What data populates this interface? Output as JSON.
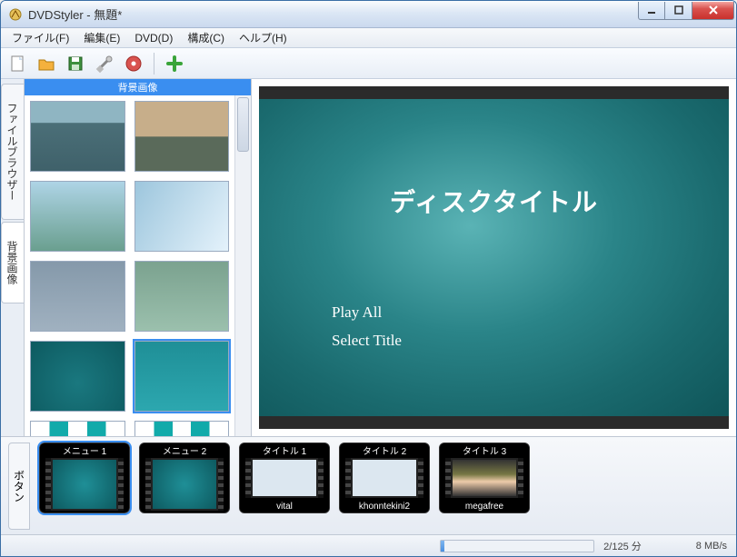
{
  "window": {
    "title": "DVDStyler - 無題*"
  },
  "menu": {
    "file": "ファイル(F)",
    "edit": "編集(E)",
    "dvd": "DVD(D)",
    "config": "構成(C)",
    "help": "ヘルプ(H)"
  },
  "tabs": {
    "file_browser": "ファイルブラウザー",
    "bg_images": "背景画像",
    "button": "ボタン"
  },
  "side_header": "背景画像",
  "preview": {
    "disc_title": "ディスクタイトル",
    "play_all": "Play All",
    "select_title": "Select Title"
  },
  "timeline": {
    "items": [
      {
        "cap": "メニュー 1",
        "sub": ""
      },
      {
        "cap": "メニュー 2",
        "sub": ""
      },
      {
        "cap": "タイトル 1",
        "sub": "vital"
      },
      {
        "cap": "タイトル 2",
        "sub": "khonntekini2"
      },
      {
        "cap": "タイトル 3",
        "sub": "megafree"
      }
    ]
  },
  "status": {
    "time": "2/125 分",
    "rate": "8 MB/s"
  },
  "icons": {
    "new": "new-file-icon",
    "open": "open-folder-icon",
    "save": "save-icon",
    "settings": "settings-icon",
    "burn": "burn-disc-icon",
    "add": "add-icon"
  }
}
